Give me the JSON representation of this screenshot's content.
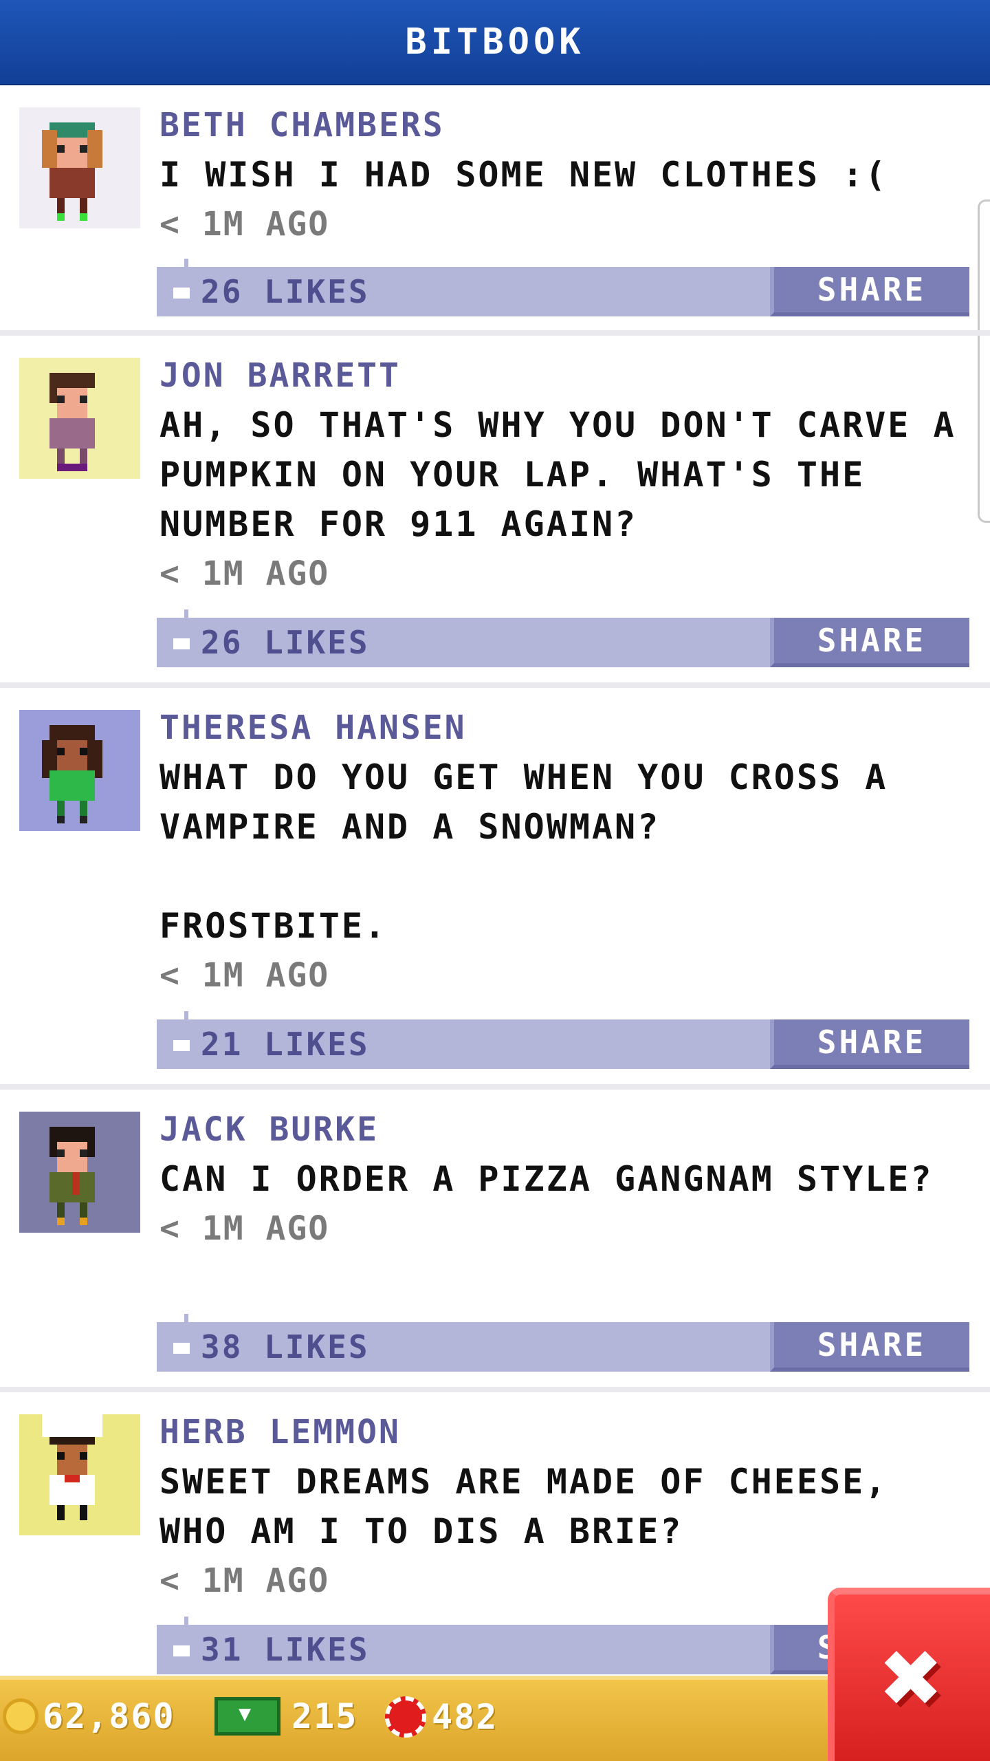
{
  "app": {
    "title": "BITBOOK"
  },
  "posts": [
    {
      "name": "BETH CHAMBERS",
      "text": "I WISH I HAD SOME NEW CLOTHES :(",
      "time": "< 1M AGO",
      "likes": "26 LIKES",
      "share_label": "SHARE",
      "avatar_bg": "#f0eef4",
      "avatar_icon": "bitizen-avatar-icon"
    },
    {
      "name": "JON BARRETT",
      "text": "AH, SO THAT'S WHY YOU DON'T CARVE A PUMPKIN ON YOUR LAP. WHAT'S THE NUMBER FOR 911 AGAIN?",
      "time": "< 1M AGO",
      "likes": "26 LIKES",
      "share_label": "SHARE",
      "avatar_bg": "#f2f0a8",
      "avatar_icon": "bitizen-avatar-icon"
    },
    {
      "name": "THERESA HANSEN",
      "text": "WHAT DO YOU GET WHEN YOU CROSS A VAMPIRE AND A SNOWMAN?\n\nFROSTBITE.",
      "time": "< 1M AGO",
      "likes": "21 LIKES",
      "share_label": "SHARE",
      "avatar_bg": "#9a9dda",
      "avatar_icon": "bitizen-avatar-icon"
    },
    {
      "name": "JACK BURKE",
      "text": "CAN I ORDER A PIZZA GANGNAM STYLE?",
      "time": "< 1M AGO",
      "likes": "38 LIKES",
      "share_label": "SHARE",
      "avatar_bg": "#7d7ca6",
      "avatar_icon": "bitizen-avatar-icon"
    },
    {
      "name": "HERB LEMMON",
      "text": "SWEET DREAMS ARE MADE OF CHEESE, WHO AM I TO DIS A BRIE?",
      "time": "< 1M AGO",
      "likes": "31 LIKES",
      "share_label": "SHARE",
      "avatar_bg": "#ece884",
      "avatar_icon": "chef-avatar-icon"
    }
  ],
  "status_bar": {
    "coins": "62,860",
    "bux": "215",
    "tokens": "482"
  },
  "colors": {
    "header": "#1a4fae",
    "name": "#5b5a99",
    "likes_bar": "#b3b6d9",
    "share_button": "#7b7fb5",
    "bottom_bar": "#e8b63a",
    "close_button": "#e02a2a"
  }
}
